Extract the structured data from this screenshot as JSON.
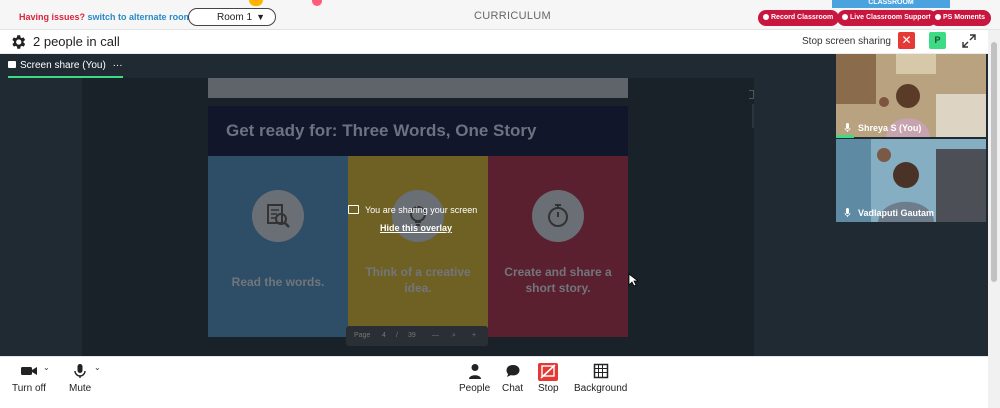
{
  "topbar": {
    "issues_text": "Having issues?",
    "alternate_link": "switch to alternate room",
    "room_label": "Room 1",
    "curriculum": "CURRICULUM",
    "logo_text": "CLASSROOM",
    "record_label": "Record Classroom",
    "support_label": "Live Classroom Support",
    "moments_label": "PS Moments"
  },
  "callbar": {
    "people_count": "2 people in call",
    "stop_share_label": "Stop screen sharing",
    "close_glyph": "✕",
    "profile_initial": "P"
  },
  "stage": {
    "share_tab_label": "Screen share (You)",
    "share_tab_menu": "···",
    "overlay_message": "You are sharing your screen",
    "hide_overlay": "Hide this overlay"
  },
  "slide": {
    "title": "Get ready for: Three Words, One Story",
    "panels": [
      {
        "text_line1": "Read the words.",
        "text_line2": "",
        "icon": "magnifier-document-icon"
      },
      {
        "text_line1": "Think of a creative",
        "text_line2": "idea.",
        "icon": "lightbulb-icon"
      },
      {
        "text_line1": "Create and share a",
        "text_line2": "short story.",
        "icon": "stopwatch-icon"
      }
    ],
    "pager": {
      "page_label": "Page",
      "page": "4",
      "sep": "/",
      "total": "39",
      "zoom_out": "—",
      "zoom_in": "+"
    }
  },
  "participants": [
    {
      "name": "Shreya S (You)"
    },
    {
      "name": "Vadlaputi Gautam"
    }
  ],
  "toolbar": {
    "video_label": "Turn off",
    "mute_label": "Mute",
    "people_label": "People",
    "chat_label": "Chat",
    "stop_label": "Stop",
    "background_label": "Background",
    "chevron": "⌄"
  },
  "colors": {
    "accent_green": "#3ddc84",
    "alert_red": "#e53935",
    "pill_red": "#c8163f",
    "stage_bg": "#1f2a33"
  }
}
